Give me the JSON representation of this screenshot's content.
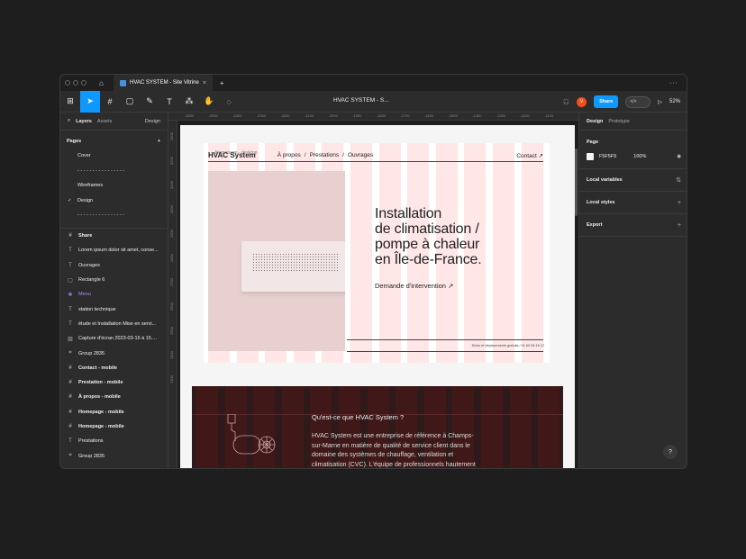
{
  "titlebar": {
    "tab_title": "HVAC SYSTEM - Site Vitrine",
    "close_glyph": "×",
    "add_glyph": "+",
    "more_glyph": "···"
  },
  "toolbar": {
    "file_title": "HVAC SYSTEM - S...",
    "user_initial": "V",
    "share_label": "Share",
    "dev_mode_label": "</>",
    "zoom": "52%"
  },
  "left_panel": {
    "tab_layers": "Layers",
    "tab_assets": "Assets",
    "design_menu": "Design",
    "pages_title": "Pages",
    "add_page": "+",
    "pages": [
      "Cover",
      "- - - - - - - - - - - - - - - -",
      "Wireframes",
      "Design",
      "- - - - - - - - - - - - - - - -"
    ],
    "selected_page_check": "✓",
    "layers": [
      {
        "icon": "#",
        "label": "Share",
        "bold": true
      },
      {
        "icon": "T",
        "label": "Lorem ipsum dolor sit amet, conse..."
      },
      {
        "icon": "T",
        "label": "Ouvrages"
      },
      {
        "icon": "▢",
        "label": "Rectangle 6"
      },
      {
        "icon": "❖",
        "label": "Menu",
        "purple": true
      },
      {
        "icon": "T",
        "label": "station technique"
      },
      {
        "icon": "T",
        "label": "étude et Installation Mise en servi..."
      },
      {
        "icon": "▨",
        "label": "Capture d'écran 2023-03-16 à 15...."
      },
      {
        "icon": "⌗",
        "label": "Group 2835"
      },
      {
        "icon": "#",
        "label": "Contact - mobile",
        "bold": true
      },
      {
        "icon": "#",
        "label": "Prestation - mobile",
        "bold": true
      },
      {
        "icon": "#",
        "label": "À propos - mobile",
        "bold": true
      },
      {
        "icon": "#",
        "label": "Homepage - mobile",
        "bold": true
      },
      {
        "icon": "#",
        "label": "Homepage - mobile",
        "bold": true
      },
      {
        "icon": "T",
        "label": "Prestations"
      },
      {
        "icon": "⌗",
        "label": "Group 2835"
      }
    ]
  },
  "canvas": {
    "frame_label": "Homepage - desktop",
    "ruler_ticks": [
      "-2600",
      "-2500",
      "-2400",
      "-2300",
      "-2200",
      "-2100",
      "-2000",
      "-1900",
      "-1800",
      "-1700",
      "-1600",
      "-1500",
      "-1400",
      "-1300",
      "-1200",
      "-1100"
    ],
    "vruler_ticks": [
      "3300",
      "3200",
      "3100",
      "3000",
      "2900",
      "2800",
      "2700",
      "2600",
      "2500",
      "2400",
      "2300"
    ],
    "site": {
      "brand": "HVAC System",
      "nav": [
        "À propos",
        "/",
        "Prestations",
        "/",
        "Ouvrages"
      ],
      "contact": "Contact  ↗",
      "heading_lines": [
        "Installation",
        "de climatisation /",
        "pompe à chaleur",
        "en Île-de-France."
      ],
      "cta": "Demande d'intervention  ↗",
      "small_note": "Devis et déplacements gratuits / 01 60 06 16 12",
      "section_title": "Qu'est-ce que HVAC System ?",
      "section_text": "HVAC System est une entreprise de référence à Champs-sur-Marne en matière de qualité de service client dans le domaine des systèmes de chauffage, ventilation et climatisation (CVC). L'équipe de professionnels hautement qualifiés est entièrement dédiée à satisfaire les besoins spécifiques de chaque client. Leurs"
    }
  },
  "right_panel": {
    "tab_design": "Design",
    "tab_prototype": "Prototype",
    "page_title": "Page",
    "bg_hex": "F5F5F5",
    "bg_opacity": "100%",
    "local_variables": "Local variables",
    "local_styles": "Local styles",
    "export": "Export",
    "help": "?"
  },
  "colors": {
    "accent": "#0d99ff",
    "avatar": "#f24e1e",
    "column_overlay": "#ffb4b4",
    "dark_section": "#2e1a1a"
  }
}
